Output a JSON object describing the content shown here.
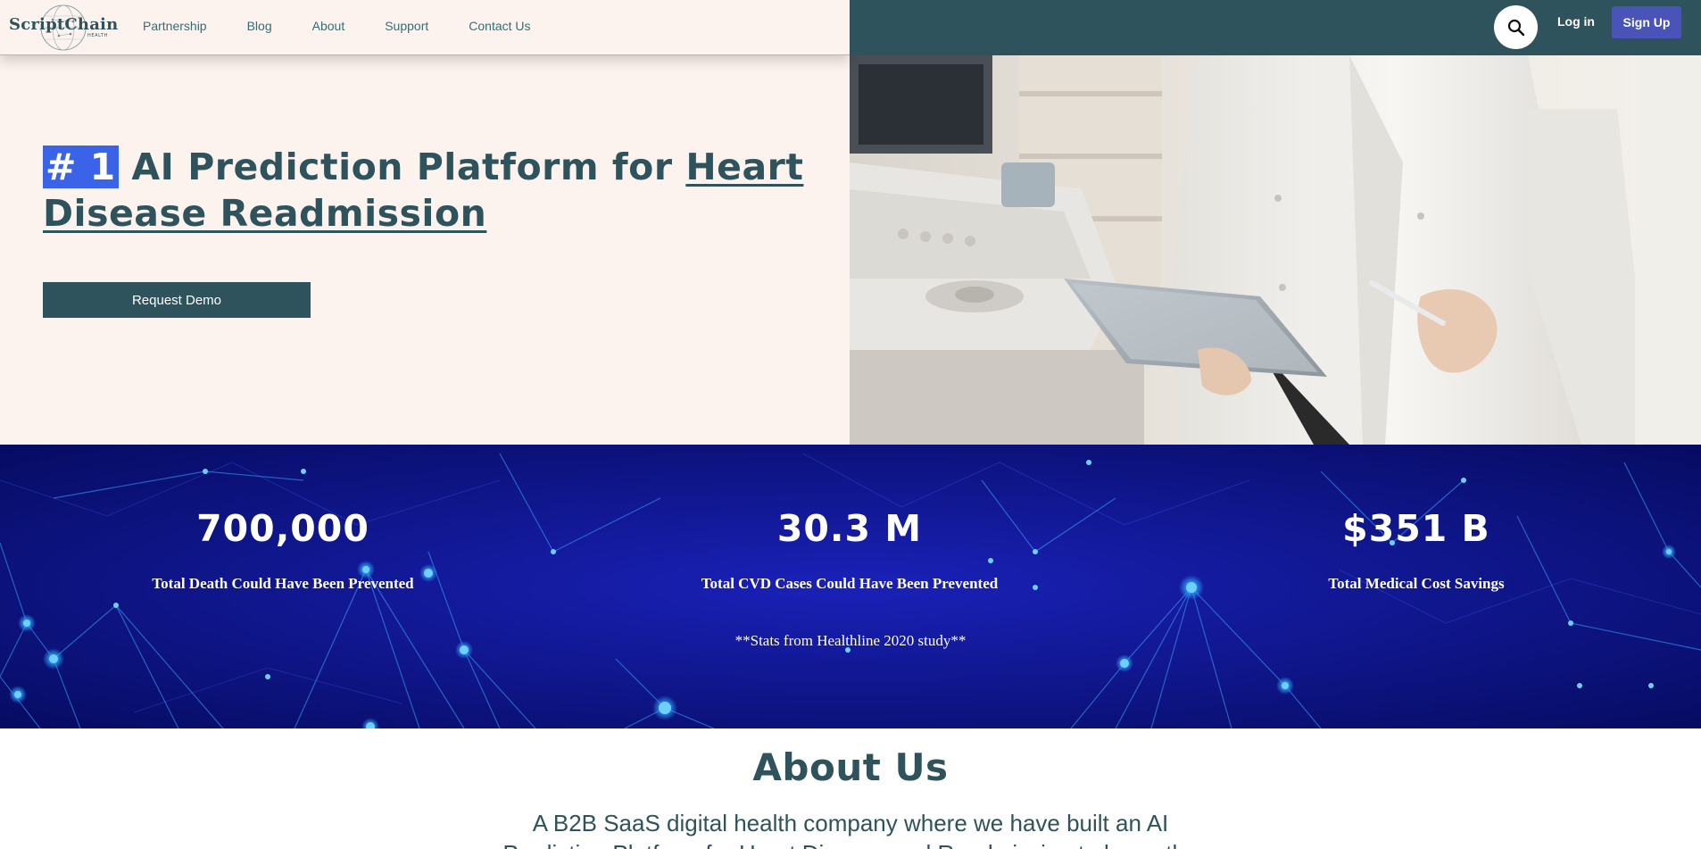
{
  "brand": {
    "name": "ScriptChain",
    "tagline": "HEALTH",
    "primary_color": "#2f535c",
    "accent_color": "#4a54b8",
    "highlight_color": "#3b63e8",
    "stats_bg_color": "#07107a"
  },
  "nav": {
    "links": [
      "Partnership",
      "Blog",
      "About",
      "Support",
      "Contact Us"
    ],
    "search_icon": "search-icon",
    "login_label": "Log in",
    "signup_label": "Sign Up"
  },
  "hero": {
    "title_highlight": "# 1",
    "title_middle": " AI Prediction Platform for ",
    "title_underlined": "Heart Disease Readmission",
    "cta_label": "Request Demo"
  },
  "stats": {
    "items": [
      {
        "value": "700,000",
        "label": "Total Death Could Have Been Prevented"
      },
      {
        "value": "30.3 M",
        "label": "Total CVD Cases Could Have Been Prevented"
      },
      {
        "value": "$351 B",
        "label": "Total Medical Cost Savings"
      }
    ],
    "note": "**Stats from Healthline 2020 study**"
  },
  "about": {
    "title": "About Us",
    "text_part1": "A B2B SaaS digital health company where we have built an AI ",
    "text_link": "Prediction Platform for Heart Disease and Readmission",
    "text_part2": " to lower the"
  }
}
